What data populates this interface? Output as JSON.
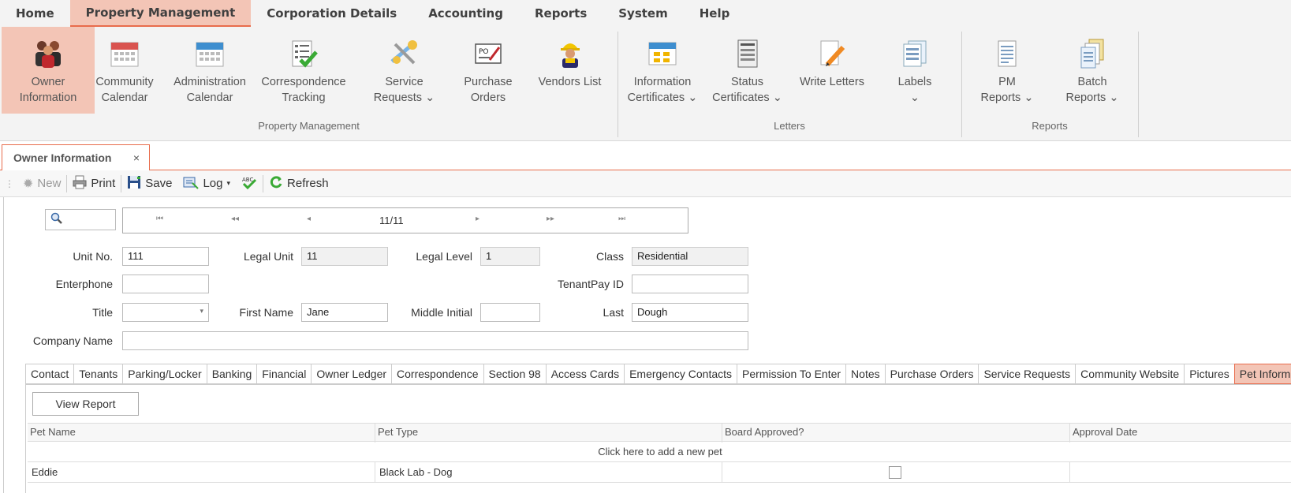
{
  "menu": {
    "items": [
      "Home",
      "Property Management",
      "Corporation Details",
      "Accounting",
      "Reports",
      "System",
      "Help"
    ],
    "active": "Property Management"
  },
  "ribbon": {
    "buttons": [
      {
        "line1": "Owner",
        "line2": "Information",
        "icon": "owners-icon"
      },
      {
        "line1": "Community",
        "line2": "Calendar",
        "icon": "calendar-icon"
      },
      {
        "line1": "Administration",
        "line2": "Calendar",
        "icon": "calendar-icon"
      },
      {
        "line1": "Correspondence",
        "line2": "Tracking",
        "icon": "checklist-icon"
      },
      {
        "line1": "Service",
        "line2": "Requests ⌄",
        "icon": "tools-icon"
      },
      {
        "line1": "Purchase",
        "line2": "Orders",
        "icon": "po-icon"
      },
      {
        "line1": "Vendors List",
        "line2": "",
        "icon": "worker-icon"
      },
      {
        "line1": "Information",
        "line2": "Certificates ⌄",
        "icon": "info-cert-icon"
      },
      {
        "line1": "Status",
        "line2": "Certificates ⌄",
        "icon": "status-cert-icon"
      },
      {
        "line1": "Write Letters",
        "line2": "",
        "icon": "pencil-icon"
      },
      {
        "line1": "Labels",
        "line2": "⌄",
        "icon": "labels-icon"
      },
      {
        "line1": "PM",
        "line2": "Reports ⌄",
        "icon": "report-icon"
      },
      {
        "line1": "Batch",
        "line2": "Reports ⌄",
        "icon": "batch-report-icon"
      }
    ],
    "groups": [
      "Property Management",
      "Letters",
      "Reports"
    ]
  },
  "doctab": {
    "title": "Owner Information",
    "close": "×"
  },
  "toolbar": {
    "new": "New",
    "print": "Print",
    "save": "Save",
    "log": "Log",
    "refresh": "Refresh"
  },
  "nav": {
    "record": "11/11",
    "first": "⏮",
    "prev_page": "◂◂",
    "prev": "◂",
    "next": "▸",
    "next_page": "▸▸",
    "last": "⏭"
  },
  "form": {
    "unit_no_label": "Unit No.",
    "unit_no": "111",
    "legal_unit_label": "Legal Unit",
    "legal_unit": "11",
    "legal_level_label": "Legal Level",
    "legal_level": "1",
    "class_label": "Class",
    "class": "Residential",
    "enterphone_label": "Enterphone",
    "enterphone": "",
    "tenantpay_label": "TenantPay ID",
    "tenantpay": "",
    "title_label": "Title",
    "title": "",
    "first_name_label": "First Name",
    "first_name": "Jane",
    "middle_initial_label": "Middle Initial",
    "middle_initial": "",
    "last_label": "Last",
    "last": "Dough",
    "company_label": "Company Name",
    "company": ""
  },
  "detail_tabs": [
    "Contact",
    "Tenants",
    "Parking/Locker",
    "Banking",
    "Financial",
    "Owner Ledger",
    "Correspondence",
    "Section 98",
    "Access Cards",
    "Emergency Contacts",
    "Permission To Enter",
    "Notes",
    "Purchase Orders",
    "Service Requests",
    "Community Website",
    "Pictures",
    "Pet Information"
  ],
  "active_detail_tab": "Pet Information",
  "pets": {
    "view_report": "View Report",
    "columns": [
      "Pet Name",
      "Pet Type",
      "Board Approved?",
      "Approval Date"
    ],
    "add_row": "Click here to add a new pet",
    "rows": [
      {
        "name": "Eddie",
        "type": "Black Lab - Dog",
        "approved": false,
        "date": ""
      }
    ]
  }
}
